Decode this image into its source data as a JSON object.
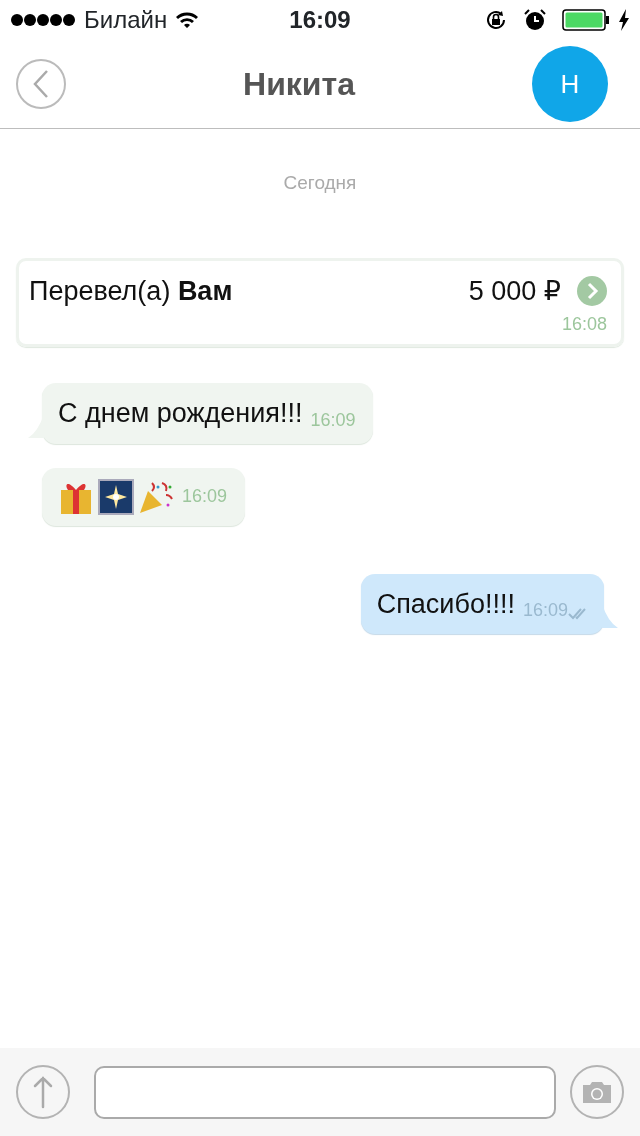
{
  "status_bar": {
    "carrier": "Билайн",
    "time": "16:09"
  },
  "header": {
    "title": "Никита",
    "avatar_initial": "Н"
  },
  "date_divider": "Сегодня",
  "messages": [
    {
      "kind": "transfer",
      "text": "Перевел(а) **Вам**",
      "amount": "5 000 ₽",
      "time": "16:08"
    },
    {
      "kind": "incoming",
      "text": "С днем рождения!!!",
      "time": "16:09"
    },
    {
      "kind": "emoji",
      "time": "16:09"
    },
    {
      "kind": "outgoing",
      "text": "Спасибо!!!!",
      "time": "16:09",
      "read": true
    }
  ]
}
